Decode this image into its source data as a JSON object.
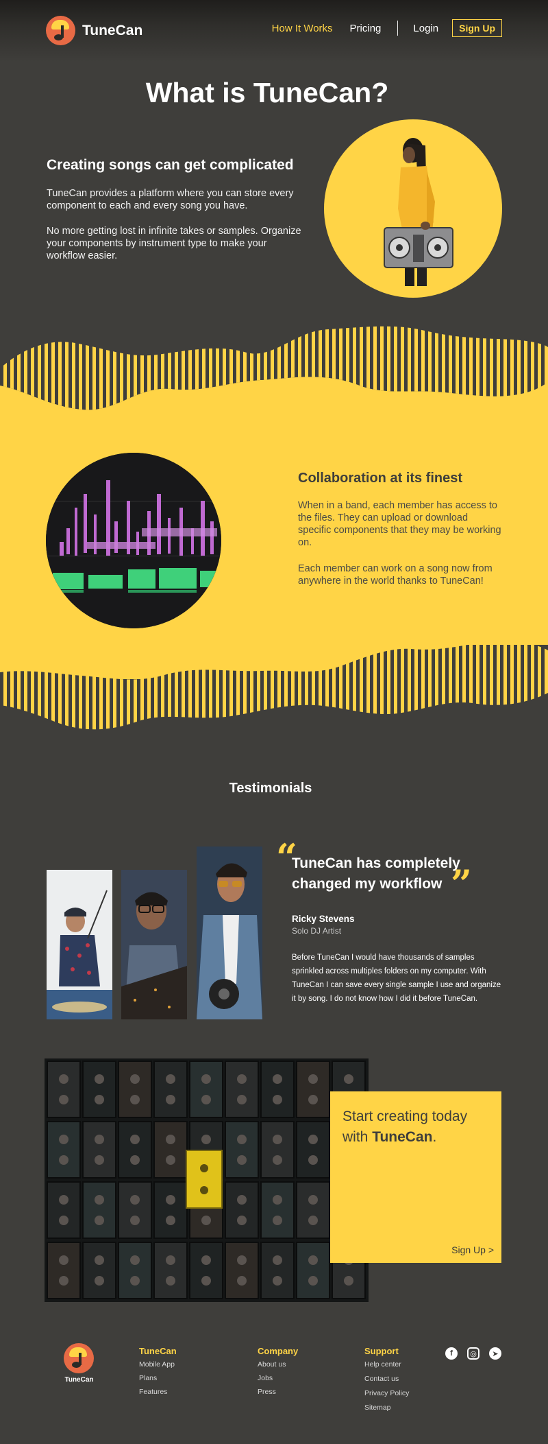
{
  "brand": {
    "name": "TuneCan"
  },
  "nav": {
    "how_it_works": "How It Works",
    "pricing": "Pricing",
    "login": "Login",
    "sign_up": "Sign Up"
  },
  "hero": {
    "title": "What is TuneCan?",
    "subtitle": "Creating songs can get complicated",
    "paragraph_1": "TuneCan provides a platform where you can store every component to each and every song you have.",
    "paragraph_2": "No more getting lost in infinite takes or samples. Organize your components by instrument type to make your workflow easier."
  },
  "collaboration": {
    "title": "Collaboration at its finest",
    "paragraph_1": "When in a band, each member has access to the files. They can upload or download specific components that they may be working on.",
    "paragraph_2": "Each member can work on a song now from anywhere in the world thanks to TuneCan!"
  },
  "testimonials": {
    "heading": "Testimonials",
    "quote": "TuneCan has completely changed my workflow",
    "author": "Ricky Stevens",
    "role": "Solo DJ Artist",
    "body": "Before TuneCan I would have thousands of samples sprinkled across multiples folders on my computer. With TuneCan I can save every single sample I use and organize it by song.  I do not know how I did it before TuneCan."
  },
  "cta": {
    "text_prefix": "Start creating today with ",
    "text_brand": "TuneCan",
    "text_suffix": ".",
    "sign_up": "Sign Up >"
  },
  "footer": {
    "logo_text": "TuneCan",
    "columns": [
      {
        "title": "TuneCan",
        "links": [
          "Mobile App",
          "Plans",
          "Features"
        ]
      },
      {
        "title": "Company",
        "links": [
          "About us",
          "Jobs",
          "Press"
        ]
      },
      {
        "title": "Support",
        "links": [
          "Help center",
          "Contact us",
          "Privacy Policy",
          "Sitemap"
        ]
      }
    ],
    "social": [
      "facebook-icon",
      "instagram-icon",
      "twitter-icon"
    ]
  },
  "colors": {
    "accent": "#ffd446",
    "background": "#3f3e3b",
    "logo": "#e86a45"
  }
}
